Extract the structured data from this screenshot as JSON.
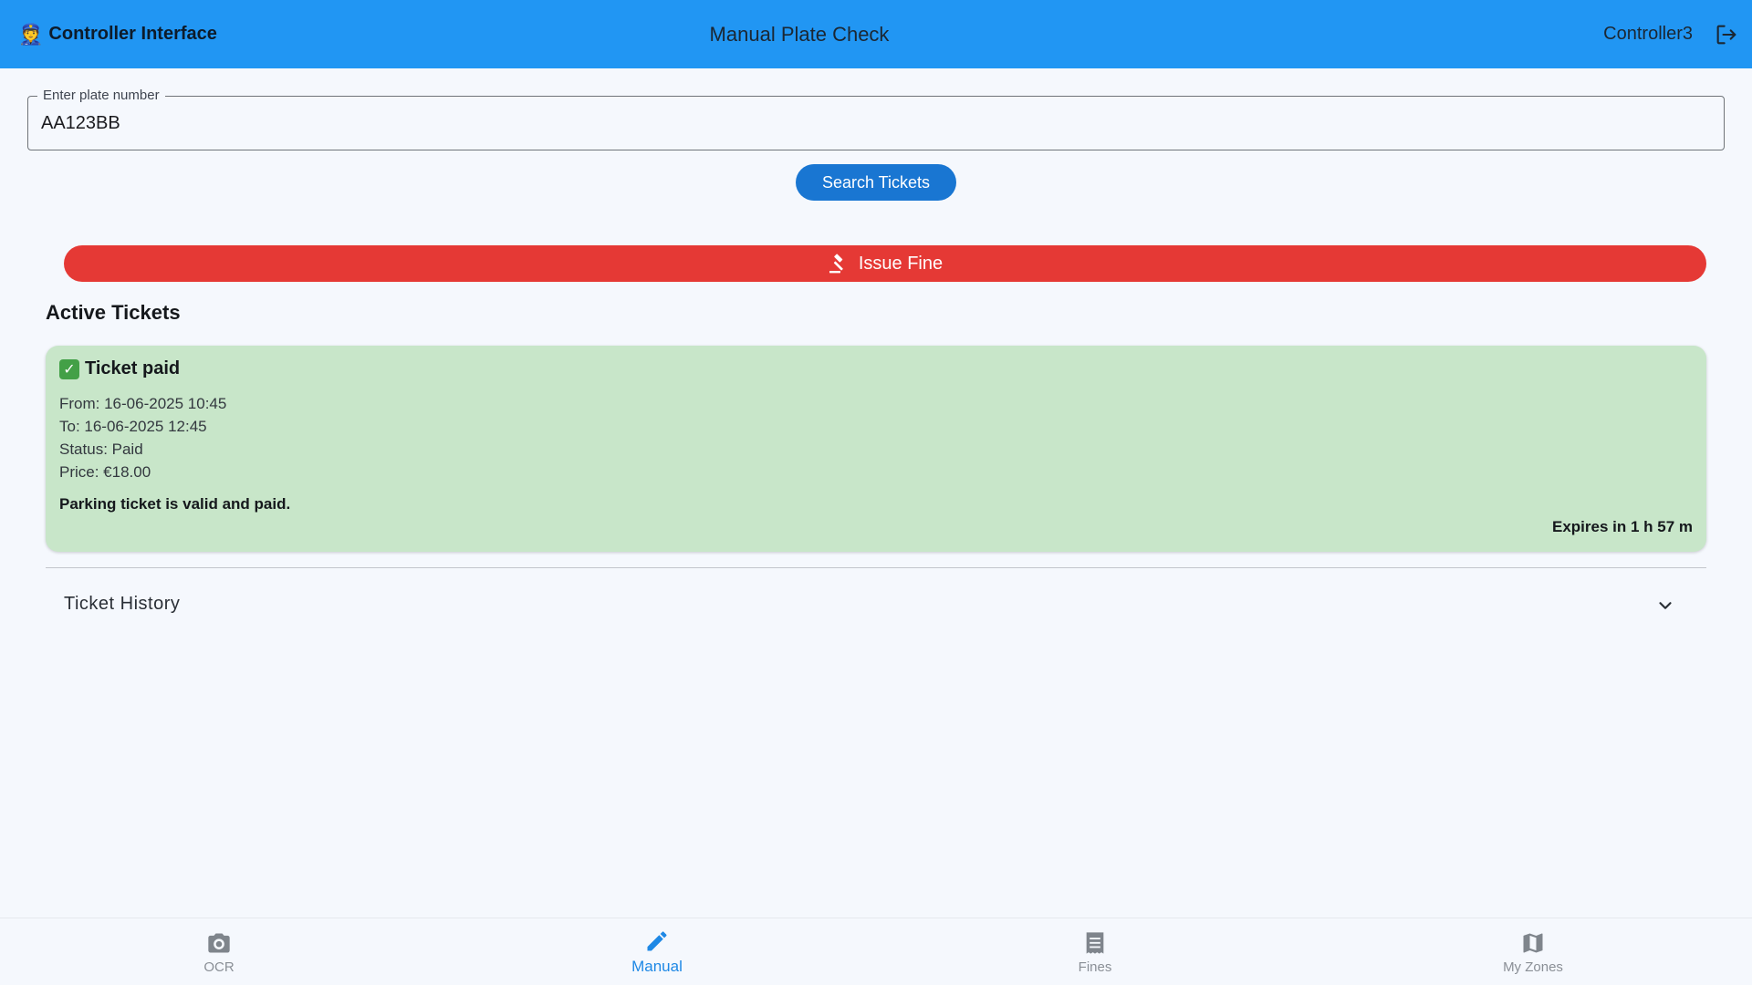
{
  "appbar": {
    "brand_emoji": "👮",
    "brand_title": "Controller Interface",
    "page_title": "Manual Plate Check",
    "user_name": "Controller3",
    "logout_icon": "logout-icon"
  },
  "search": {
    "label": "Enter plate number",
    "value": "AA123BB",
    "button_label": "Search Tickets"
  },
  "fine": {
    "button_label": "Issue Fine",
    "icon": "gavel-icon"
  },
  "active_tickets": {
    "title": "Active Tickets",
    "tickets": [
      {
        "badge": "✓",
        "title": "Ticket paid",
        "from": "From: 16-06-2025 10:45",
        "to": "To: 16-06-2025 12:45",
        "status": "Status: Paid",
        "price": "Price: €18.00",
        "message": "Parking ticket is valid and paid.",
        "expiry": "Expires in 1 h 57 m"
      }
    ]
  },
  "history": {
    "label": "Ticket History",
    "icon": "chevron-down-icon"
  },
  "bottom_nav": {
    "items": [
      {
        "label": "OCR",
        "icon": "camera-icon",
        "active": false
      },
      {
        "label": "Manual",
        "icon": "pencil-icon",
        "active": true
      },
      {
        "label": "Fines",
        "icon": "receipt-icon",
        "active": false
      },
      {
        "label": "My Zones",
        "icon": "map-icon",
        "active": false
      }
    ]
  },
  "colors": {
    "appbar": "#2196f3",
    "primary_button": "#1976d2",
    "danger_button": "#e53935",
    "ticket_paid_bg": "#c8e6c9",
    "nav_active": "#1e88e5",
    "nav_inactive": "#8a8f96"
  }
}
